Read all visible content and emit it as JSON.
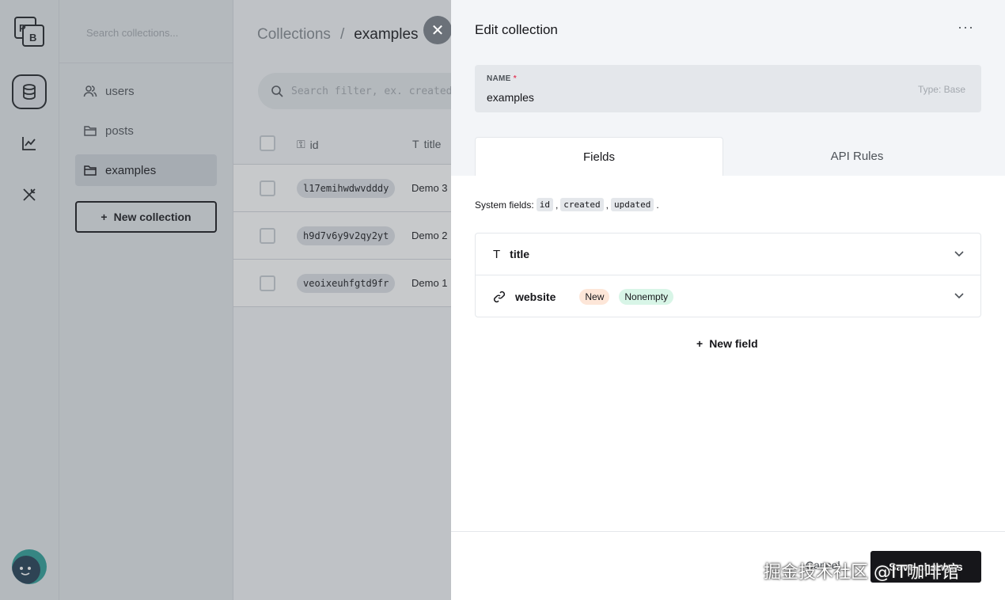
{
  "sidebar": {
    "search_placeholder": "Search collections...",
    "items": [
      {
        "label": "users",
        "icon": "users-icon"
      },
      {
        "label": "posts",
        "icon": "folder-icon"
      },
      {
        "label": "examples",
        "icon": "folder-icon"
      }
    ],
    "new_collection_label": "New collection"
  },
  "header": {
    "breadcrumb_root": "Collections",
    "breadcrumb_sep": "/",
    "breadcrumb_current": "examples"
  },
  "toolbar": {
    "filter_placeholder": "Search filter, ex. created >"
  },
  "table": {
    "columns": [
      "id",
      "title"
    ],
    "rows": [
      {
        "id": "l17emihwdwvdddy",
        "title": "Demo 3"
      },
      {
        "id": "h9d7v6y9v2qy2yt",
        "title": "Demo 2"
      },
      {
        "id": "veoixeuhfgtd9fr",
        "title": "Demo 1"
      }
    ]
  },
  "panel": {
    "title": "Edit collection",
    "more_label": "···",
    "name_label": "NAME",
    "name_required": "*",
    "name_value": "examples",
    "type_label": "Type: Base",
    "tabs": [
      "Fields",
      "API Rules"
    ],
    "system_fields_prefix": "System fields:",
    "system_fields": [
      "id",
      "created",
      "updated"
    ],
    "fields": [
      {
        "name": "title",
        "icon": "text-icon",
        "badges": []
      },
      {
        "name": "website",
        "icon": "link-icon",
        "badges": [
          "New",
          "Nonempty"
        ]
      }
    ],
    "new_field_label": "New field",
    "cancel_label": "Cancel",
    "save_label": "Save changes"
  },
  "watermark": "掘金技术社区 @IT咖啡馆",
  "colors": {
    "accent": "#16161a",
    "badge_new": "#fde6d8",
    "badge_nonempty": "#d8f5e7",
    "required": "#e34562"
  }
}
